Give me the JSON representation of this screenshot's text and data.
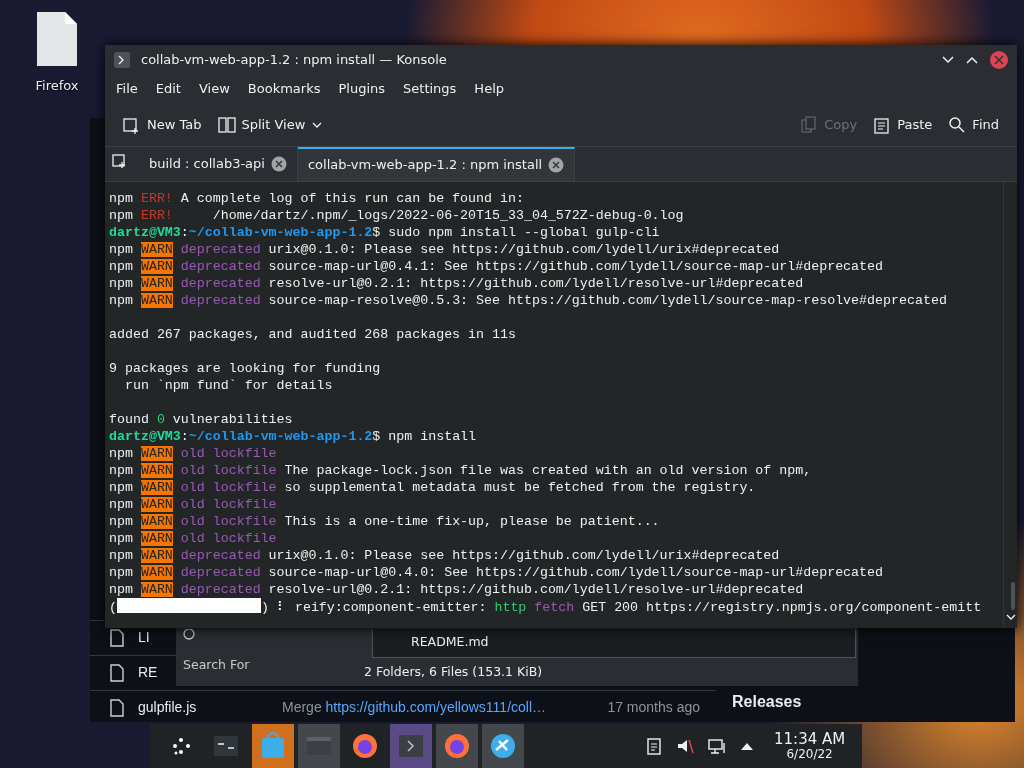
{
  "desktop": {
    "icons": [
      {
        "label": "Firefox"
      }
    ]
  },
  "background_window": {
    "files": [
      {
        "name": "LI"
      },
      {
        "name": "RE"
      },
      {
        "name": "gulpfile.js",
        "message": "Merge ",
        "link": "https://github.com/yellows111/coll…",
        "age": "17 months ago"
      }
    ],
    "side_heading": "Releases"
  },
  "dialog": {
    "search_label": "Search For",
    "file": "README.md",
    "status": "2 Folders, 6 Files (153.1 KiB)"
  },
  "konsole": {
    "title": "collab-vm-web-app-1.2 : npm install — Konsole",
    "menu": [
      "File",
      "Edit",
      "View",
      "Bookmarks",
      "Plugins",
      "Settings",
      "Help"
    ],
    "toolbar_left": [
      {
        "kind": "newtab",
        "label": "New Tab",
        "disabled": false
      },
      {
        "kind": "split",
        "label": "Split View",
        "disabled": false
      }
    ],
    "toolbar_right": [
      {
        "kind": "copy",
        "label": "Copy",
        "disabled": true
      },
      {
        "kind": "paste",
        "label": "Paste",
        "disabled": false
      },
      {
        "kind": "find",
        "label": "Find",
        "disabled": false
      }
    ],
    "tabs": [
      {
        "label": "build : collab3-api",
        "selected": false
      },
      {
        "label": "collab-vm-web-app-1.2 : npm install",
        "selected": true
      }
    ],
    "lines": [
      {
        "segments": [
          {
            "kind": "plain",
            "t": "npm "
          },
          {
            "kind": "err",
            "t": "ERR!"
          },
          {
            "kind": "plain",
            "t": " A complete log of this run can be found in:"
          }
        ]
      },
      {
        "segments": [
          {
            "kind": "plain",
            "t": "npm "
          },
          {
            "kind": "err",
            "t": "ERR!"
          },
          {
            "kind": "plain",
            "t": "     /home/dartz/.npm/_logs/2022-06-20T15_33_04_572Z-debug-0.log"
          }
        ]
      },
      {
        "segments": [
          {
            "kind": "user",
            "t": "dartz@VM3"
          },
          {
            "kind": "plain",
            "t": ":"
          },
          {
            "kind": "path",
            "t": "~/collab-vm-web-app-1.2"
          },
          {
            "kind": "plain",
            "t": "$ sudo npm install --global gulp-cli"
          }
        ]
      },
      {
        "segments": [
          {
            "kind": "plain",
            "t": "npm "
          },
          {
            "kind": "warn",
            "t": "WARN"
          },
          {
            "kind": "dep",
            "t": " deprecated"
          },
          {
            "kind": "plain",
            "t": " urix@0.1.0: Please see https://github.com/lydell/urix#deprecated"
          }
        ]
      },
      {
        "segments": [
          {
            "kind": "plain",
            "t": "npm "
          },
          {
            "kind": "warn",
            "t": "WARN"
          },
          {
            "kind": "dep",
            "t": " deprecated"
          },
          {
            "kind": "plain",
            "t": " source-map-url@0.4.1: See https://github.com/lydell/source-map-url#deprecated"
          }
        ]
      },
      {
        "segments": [
          {
            "kind": "plain",
            "t": "npm "
          },
          {
            "kind": "warn",
            "t": "WARN"
          },
          {
            "kind": "dep",
            "t": " deprecated"
          },
          {
            "kind": "plain",
            "t": " resolve-url@0.2.1: https://github.com/lydell/resolve-url#deprecated"
          }
        ]
      },
      {
        "segments": [
          {
            "kind": "plain",
            "t": "npm "
          },
          {
            "kind": "warn",
            "t": "WARN"
          },
          {
            "kind": "dep",
            "t": " deprecated"
          },
          {
            "kind": "plain",
            "t": " source-map-resolve@0.5.3: See https://github.com/lydell/source-map-resolve#deprecated"
          }
        ]
      },
      {
        "gap": true,
        "segments": [
          {
            "kind": "plain",
            "t": "added 267 packages, and audited 268 packages in 11s"
          }
        ]
      },
      {
        "gap": true,
        "segments": [
          {
            "kind": "plain",
            "t": "9 packages are looking for funding"
          }
        ]
      },
      {
        "segments": [
          {
            "kind": "plain",
            "t": "  run `npm fund` for details"
          }
        ]
      },
      {
        "gap": true,
        "segments": [
          {
            "kind": "plain",
            "t": "found "
          },
          {
            "kind": "ok",
            "t": "0"
          },
          {
            "kind": "plain",
            "t": " vulnerabilities"
          }
        ]
      },
      {
        "segments": [
          {
            "kind": "user",
            "t": "dartz@VM3"
          },
          {
            "kind": "plain",
            "t": ":"
          },
          {
            "kind": "path",
            "t": "~/collab-vm-web-app-1.2"
          },
          {
            "kind": "plain",
            "t": "$ npm install"
          }
        ]
      },
      {
        "segments": [
          {
            "kind": "plain",
            "t": "npm "
          },
          {
            "kind": "warn",
            "t": "WARN"
          },
          {
            "kind": "dep",
            "t": " old lockfile"
          }
        ]
      },
      {
        "segments": [
          {
            "kind": "plain",
            "t": "npm "
          },
          {
            "kind": "warn",
            "t": "WARN"
          },
          {
            "kind": "dep",
            "t": " old lockfile"
          },
          {
            "kind": "plain",
            "t": " The package-lock.json file was created with an old version of npm,"
          }
        ]
      },
      {
        "segments": [
          {
            "kind": "plain",
            "t": "npm "
          },
          {
            "kind": "warn",
            "t": "WARN"
          },
          {
            "kind": "dep",
            "t": " old lockfile"
          },
          {
            "kind": "plain",
            "t": " so supplemental metadata must be fetched from the registry."
          }
        ]
      },
      {
        "segments": [
          {
            "kind": "plain",
            "t": "npm "
          },
          {
            "kind": "warn",
            "t": "WARN"
          },
          {
            "kind": "dep",
            "t": " old lockfile"
          }
        ]
      },
      {
        "segments": [
          {
            "kind": "plain",
            "t": "npm "
          },
          {
            "kind": "warn",
            "t": "WARN"
          },
          {
            "kind": "dep",
            "t": " old lockfile"
          },
          {
            "kind": "plain",
            "t": " This is a one-time fix-up, please be patient..."
          }
        ]
      },
      {
        "segments": [
          {
            "kind": "plain",
            "t": "npm "
          },
          {
            "kind": "warn",
            "t": "WARN"
          },
          {
            "kind": "dep",
            "t": " old lockfile"
          }
        ]
      },
      {
        "segments": [
          {
            "kind": "plain",
            "t": "npm "
          },
          {
            "kind": "warn",
            "t": "WARN"
          },
          {
            "kind": "dep",
            "t": " deprecated"
          },
          {
            "kind": "plain",
            "t": " urix@0.1.0: Please see https://github.com/lydell/urix#deprecated"
          }
        ]
      },
      {
        "segments": [
          {
            "kind": "plain",
            "t": "npm "
          },
          {
            "kind": "warn",
            "t": "WARN"
          },
          {
            "kind": "dep",
            "t": " deprecated"
          },
          {
            "kind": "plain",
            "t": " source-map-url@0.4.0: See https://github.com/lydell/source-map-url#deprecated"
          }
        ]
      },
      {
        "segments": [
          {
            "kind": "plain",
            "t": "npm "
          },
          {
            "kind": "warn",
            "t": "WARN"
          },
          {
            "kind": "dep",
            "t": " deprecated"
          },
          {
            "kind": "plain",
            "t": " resolve-url@0.2.1: https://github.com/lydell/resolve-url#deprecated"
          }
        ]
      },
      {
        "segments": [
          {
            "kind": "plain",
            "t": "("
          },
          {
            "kind": "redacted"
          },
          {
            "kind": "plain",
            "t": ") ⠇ reify:component-emitter: "
          },
          {
            "kind": "ok",
            "t": "http"
          },
          {
            "kind": "dep",
            "t": " fetch"
          },
          {
            "kind": "plain",
            "t": " GET 200 https://registry.npmjs.org/component-emitt"
          }
        ]
      }
    ]
  },
  "taskbar": {
    "tasks": [
      {
        "kind": "pager",
        "running": false,
        "active": false,
        "attention": false
      },
      {
        "kind": "store",
        "running": true,
        "active": false,
        "attention": true
      },
      {
        "kind": "files",
        "running": true,
        "active": false,
        "attention": false
      },
      {
        "kind": "firefox",
        "running": false,
        "active": false,
        "attention": false
      },
      {
        "kind": "terminal",
        "running": true,
        "active": true,
        "attention": false
      },
      {
        "kind": "firefox",
        "running": true,
        "active": false,
        "attention": false
      },
      {
        "kind": "app",
        "running": true,
        "active": false,
        "attention": false
      }
    ],
    "clock": {
      "time": "11:34 AM",
      "date": "6/20/22"
    }
  }
}
